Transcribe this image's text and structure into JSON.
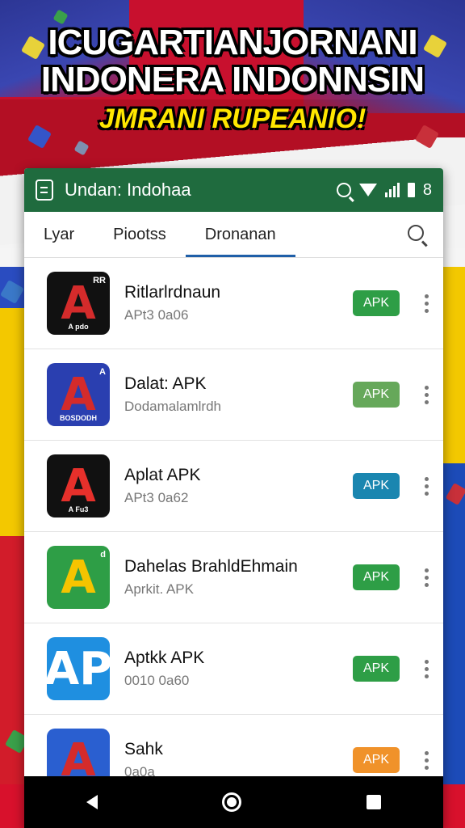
{
  "banner": {
    "line1": "ICUGARTIANJORNANI",
    "line2": "INDONERA INDONNSIN",
    "line3": "JMRANI RUPEANIO!"
  },
  "appbar": {
    "title": "Undan: Indohaa",
    "status_number": "8",
    "icons": [
      "app-logo-icon",
      "search-icon",
      "wifi-icon",
      "signal-icon",
      "battery-icon"
    ]
  },
  "tabs": [
    {
      "label": "Lyar",
      "active": false
    },
    {
      "label": "Piootss",
      "active": false
    },
    {
      "label": "Dronanan",
      "active": true
    }
  ],
  "apps": [
    {
      "name": "Ritlarlrdnaun",
      "meta": "APt3 0a06",
      "button": "APK",
      "button_color": "#2e9e46",
      "icon_bg": "#111111",
      "icon_letter": "A",
      "icon_letter_color": "#d42b2b",
      "icon_badge": "RR",
      "icon_caption": "A pdo"
    },
    {
      "name": "Dalat: APK",
      "meta": "Dodamalamlrdh",
      "button": "APK",
      "button_color": "#66a85a",
      "icon_bg": "#2a3fb0",
      "icon_letter": "A",
      "icon_letter_color": "#d42b2b",
      "icon_badge": "A",
      "icon_caption": "BOSDODH"
    },
    {
      "name": "Aplat APK",
      "meta": "APt3 0a62",
      "button": "APK",
      "button_color": "#1a86b0",
      "icon_bg": "#111111",
      "icon_letter": "A",
      "icon_letter_color": "#e6302b",
      "icon_badge": "",
      "icon_caption": "A Fu3"
    },
    {
      "name": "Dahelas BrahldEhmain",
      "meta": "Aprkit. APK",
      "button": "APK",
      "button_color": "#2e9e46",
      "icon_bg": "#2e9e46",
      "icon_letter": "A",
      "icon_letter_color": "#f5c400",
      "icon_badge": "d",
      "icon_caption": ""
    },
    {
      "name": "Aptkk APK",
      "meta": "0010 0a60",
      "button": "APK",
      "button_color": "#2e9e46",
      "icon_bg": "#1f8fe0",
      "icon_letter": "AP",
      "icon_letter_color": "#ffffff",
      "icon_badge": "",
      "icon_caption": ""
    },
    {
      "name": "Sahk",
      "meta": "0a0a",
      "button": "APK",
      "button_color": "#f0922a",
      "icon_bg": "#2a5fd0",
      "icon_letter": "A",
      "icon_letter_color": "#d42b2b",
      "icon_badge": "",
      "icon_caption": ""
    }
  ],
  "navbar": {
    "icons": [
      "back-icon",
      "home-icon",
      "recents-icon"
    ]
  },
  "colors": {
    "appbar": "#1f6b3e",
    "tab_indicator": "#1f5fa8"
  }
}
